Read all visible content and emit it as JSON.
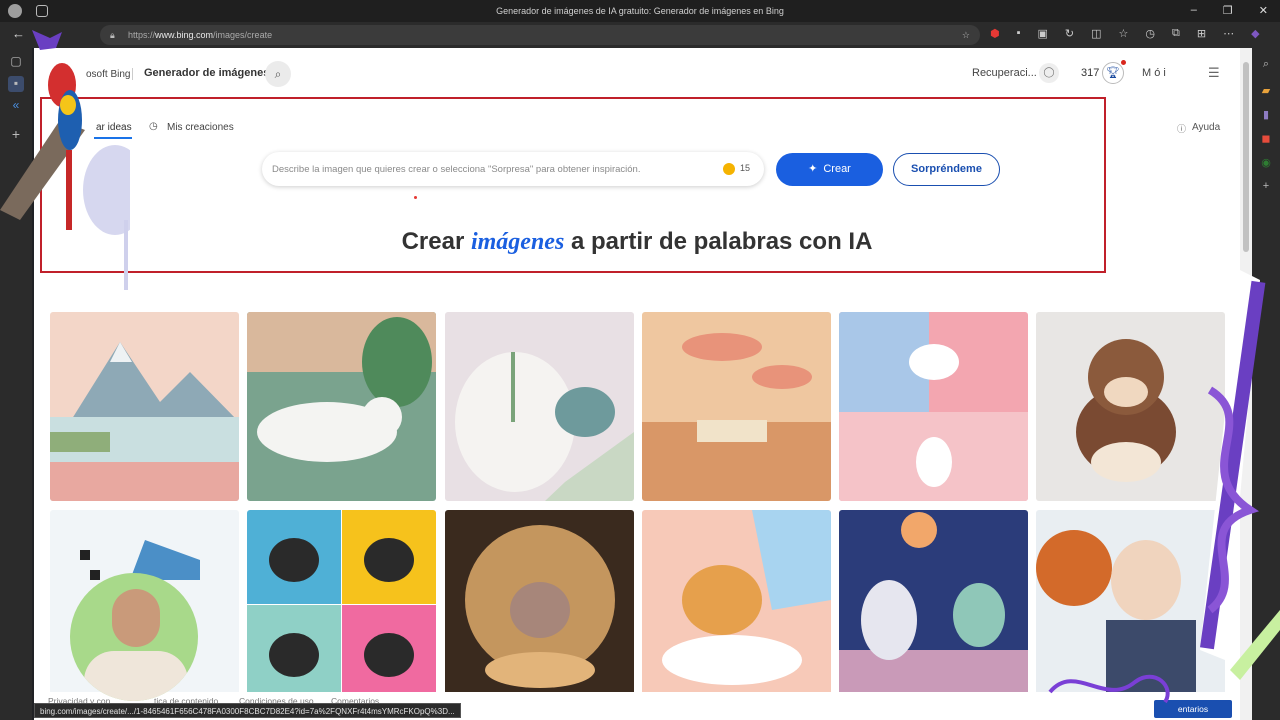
{
  "browser": {
    "window_title": "Generador de imágenes de IA gratuito: Generador de imágenes en Bing",
    "url_prefix": "https://",
    "url_domain": "www.bing.com",
    "url_path": "/images/create",
    "status_url": "bing.com/images/create/.../1-8465461F656C478FA0300F8CBC7D82E4?id=7a%2FQNXFr4t4msYMRcFKOpQ%3D..."
  },
  "header": {
    "logo": "osoft Bing",
    "title": "Generador de imágenes",
    "user": "Recuperaci...",
    "points": "317",
    "name": "M ó i"
  },
  "tabs": {
    "explore": "ar ideas",
    "mine": "Mis creaciones",
    "help": "Ayuda"
  },
  "prompt": {
    "placeholder": "Describe la imagen que quieres crear o selecciona \"Sorpresa\" para obtener inspiración.",
    "boosts": "15",
    "create": "Crear",
    "surprise": "Sorpréndeme"
  },
  "hero": {
    "pre": "Crear ",
    "highlight": "imágenes",
    "post": " a partir de palabras con IA"
  },
  "footer": {
    "privacy": "Privacidad y con",
    "privacy_suffix": "tica de contenido",
    "terms": "Condiciones de uso",
    "comments": "Comentarios",
    "feedback": "entarios"
  },
  "colors": {
    "accent": "#1a5fe0",
    "highlight_box": "#c0202a"
  }
}
